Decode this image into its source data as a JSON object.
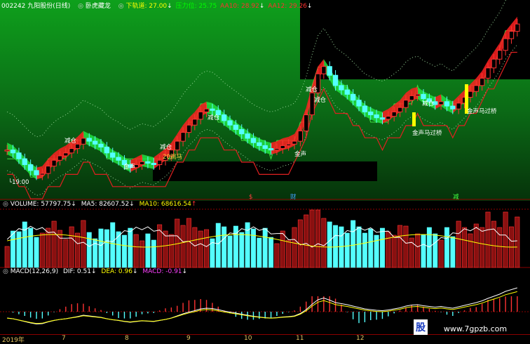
{
  "top_bar": {
    "stock": "002242 九阳股份(日线)",
    "indicator_name": "卧虎藏龙",
    "lower_channel": "下轨道: 27.00",
    "pressure": "压力位: 25.75",
    "aa10": "AA10: 28.92",
    "aa12": "AA12: 29.26"
  },
  "labels": {
    "min_price": "19.00",
    "signals": [
      "减仓",
      "减仓",
      "减仓",
      "减仓",
      "减仓",
      "减仓"
    ],
    "bottom_signals": [
      "金声",
      "金声",
      "20跳马",
      "金声马过桥",
      "金声马过桥"
    ],
    "event_marks": [
      "$",
      "财",
      "减"
    ]
  },
  "volume_panel": {
    "volume": "VOLUME: 57797.75",
    "ma5": "MA5: 82607.52",
    "ma10": "MA10: 68616.54"
  },
  "macd_panel": {
    "title": "MACD(12,26,9)",
    "dif": "DIF: 0.51",
    "dea": "DEA: 0.96",
    "macd": "MACD: -0.91"
  },
  "x_axis": [
    "2019年",
    "7",
    "8",
    "9",
    "10",
    "11",
    "12"
  ],
  "watermark": {
    "logo": "股",
    "site": "www.7gpzb.com"
  },
  "colors": {
    "up": "#ff3232",
    "down": "#54ffff",
    "bg_green": "#0a9a1a",
    "yellow": "#ffff00",
    "red_line": "#e02020",
    "ma5": "#ffffff",
    "ma10": "#ffff00",
    "macd_pos": "#ff3232",
    "macd_neg": "#54ffff"
  },
  "chart_data": {
    "type": "candlestick",
    "price_ylim": [
      18.5,
      30
    ],
    "closes": [
      21.2,
      21.0,
      20.6,
      20.2,
      19.8,
      19.5,
      19.6,
      20.1,
      20.5,
      20.8,
      21.0,
      21.3,
      21.6,
      22.0,
      21.8,
      21.6,
      21.4,
      21.0,
      20.7,
      20.5,
      20.2,
      20.0,
      20.2,
      20.4,
      20.3,
      20.2,
      20.5,
      20.8,
      21.2,
      21.8,
      22.4,
      22.9,
      23.3,
      23.8,
      24.0,
      23.9,
      23.6,
      23.2,
      22.9,
      22.6,
      22.3,
      22.0,
      21.7,
      21.5,
      21.3,
      21.2,
      21.3,
      21.5,
      21.6,
      21.8,
      22.5,
      23.6,
      25.1,
      26.4,
      26.9,
      26.3,
      25.6,
      25.3,
      25.0,
      24.6,
      24.2,
      23.8,
      23.6,
      23.4,
      23.3,
      23.5,
      23.8,
      24.1,
      24.6,
      24.9,
      25.0,
      24.7,
      24.5,
      24.3,
      24.5,
      24.2,
      24.0,
      24.4,
      24.8,
      25.2,
      25.6,
      26.1,
      26.8,
      27.4,
      28.0,
      28.8,
      29.3,
      29.8
    ]
  }
}
